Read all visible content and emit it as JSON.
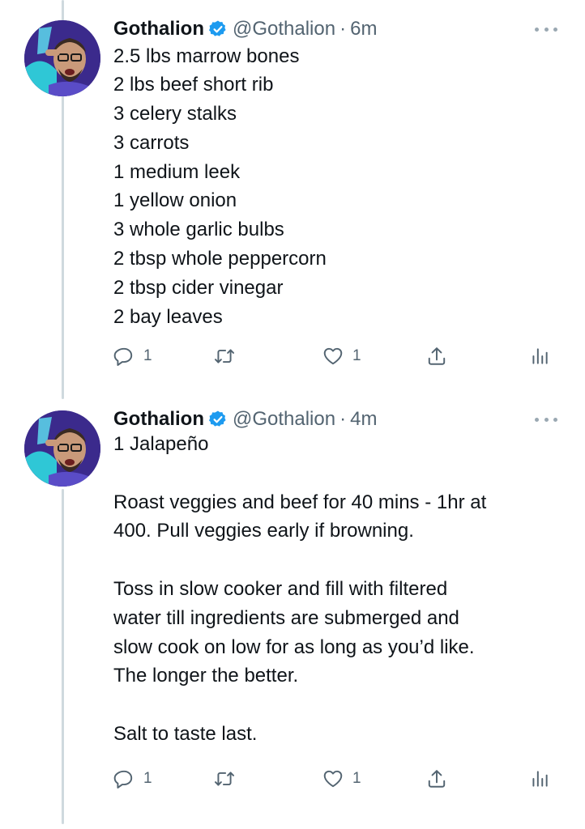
{
  "tweets": [
    {
      "author": {
        "name": "Gothalion",
        "handle": "@Gothalion",
        "separator": "·",
        "time": "6m"
      },
      "lines": [
        "2.5 lbs marrow bones",
        "2 lbs beef short rib",
        "3 celery stalks",
        "3 carrots",
        "1 medium leek",
        "1 yellow onion",
        "3 whole garlic bulbs",
        "2 tbsp whole peppercorn",
        "2 tbsp cider vinegar",
        "2 bay leaves"
      ],
      "actions": {
        "reply_count": "1",
        "retweet_count": "",
        "like_count": "1"
      }
    },
    {
      "author": {
        "name": "Gothalion",
        "handle": "@Gothalion",
        "separator": "·",
        "time": "4m"
      },
      "lines": [
        "1 Jalapeño",
        "",
        "Roast veggies and beef for 40 mins - 1hr at",
        "400. Pull veggies early if browning.",
        "",
        "Toss in slow cooker and fill with filtered",
        "water till ingredients are submerged and",
        "slow cook on low for as long as you’d like.",
        "The longer the better.",
        "",
        "Salt to taste last."
      ],
      "actions": {
        "reply_count": "1",
        "retweet_count": "",
        "like_count": "1"
      }
    }
  ],
  "icons": {
    "verified": "verified-badge-icon",
    "more": "more-options-icon",
    "reply": "reply-icon",
    "retweet": "retweet-icon",
    "like": "like-icon",
    "share": "share-icon",
    "analytics": "analytics-icon"
  },
  "colors": {
    "accent": "#1d9bf0",
    "text": "#0f1419",
    "secondary": "#536471",
    "thread_line": "#cfd9de",
    "avatar_bg": "#3b2a8c"
  }
}
